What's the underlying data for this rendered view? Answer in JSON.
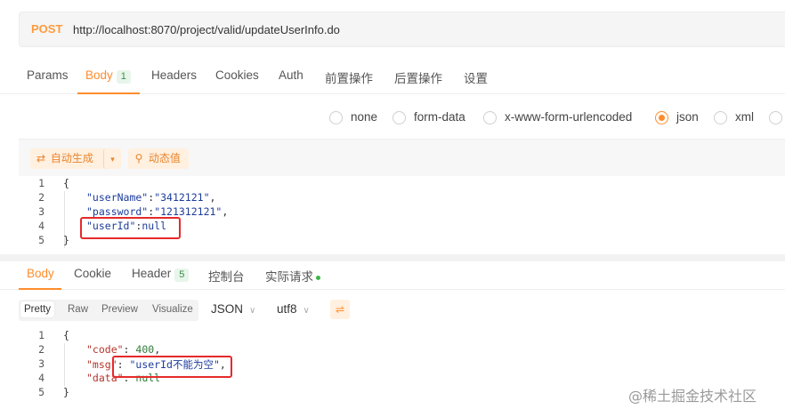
{
  "request": {
    "method": "POST",
    "url": "http://localhost:8070/project/valid/updateUserInfo.do"
  },
  "request_tabs": [
    {
      "label": "Params"
    },
    {
      "label": "Body",
      "badge": "1"
    },
    {
      "label": "Headers"
    },
    {
      "label": "Cookies"
    },
    {
      "label": "Auth"
    },
    {
      "label": "前置操作"
    },
    {
      "label": "后置操作"
    },
    {
      "label": "设置"
    }
  ],
  "body_types": [
    "none",
    "form-data",
    "x-www-form-urlencoded",
    "json",
    "xml"
  ],
  "body_type_selected": "json",
  "editor_toolbar": {
    "auto_generate": "自动生成",
    "dynamic_value": "动态值"
  },
  "request_body": {
    "line_numbers": [
      "1",
      "2",
      "3",
      "4",
      "5"
    ],
    "open": "{",
    "l2_key": "\"userName\"",
    "l2_colon": ":",
    "l2_val": "\"3412121\"",
    "l2_comma": ",",
    "l3_key": "\"password\"",
    "l3_colon": ":",
    "l3_val": "\"121312121\"",
    "l3_comma": ",",
    "l4_key": "\"userId\"",
    "l4_colon": ":",
    "l4_val": "null",
    "close": "}"
  },
  "response_tabs": [
    {
      "label": "Body"
    },
    {
      "label": "Cookie"
    },
    {
      "label": "Header",
      "badge": "5"
    },
    {
      "label": "控制台"
    },
    {
      "label": "实际请求"
    }
  ],
  "response_toolbar": {
    "views": [
      "Pretty",
      "Raw",
      "Preview",
      "Visualize"
    ],
    "active_view": "Pretty",
    "format": "JSON",
    "encoding": "utf8"
  },
  "response_body": {
    "line_numbers": [
      "1",
      "2",
      "3",
      "4",
      "5"
    ],
    "open": "{",
    "l2_key": "\"code\"",
    "l2_colon": ": ",
    "l2_val": "400",
    "l2_comma": ",",
    "l3_key": "\"msg\"",
    "l3_colon": ": ",
    "l3_val": "\"userId不能为空\"",
    "l3_comma": ",",
    "l4_key": "\"data\"",
    "l4_colon": ": ",
    "l4_val": "null",
    "close": "}"
  },
  "watermark": "@稀土掘金技术社区",
  "colors": {
    "accent": "#ff8c2b",
    "method": "#ff9a3c",
    "highlight_box": "#e52a2a"
  }
}
